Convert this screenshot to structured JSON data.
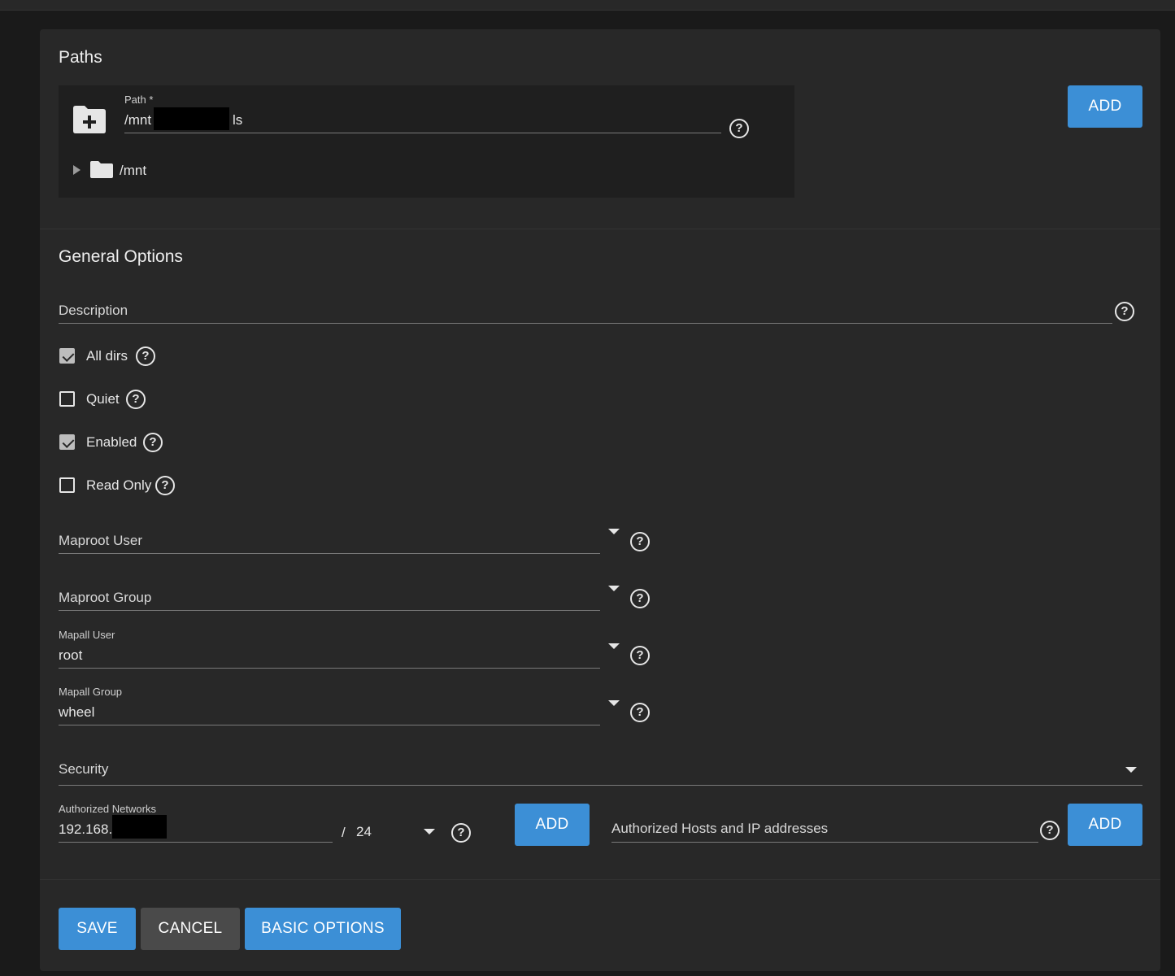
{
  "paths": {
    "title": "Paths",
    "path_label": "Path *",
    "path_value_prefix": "/mnt",
    "path_value_suffix": "ls",
    "tree_root": "/mnt",
    "add_label": "ADD"
  },
  "general": {
    "title": "General Options",
    "description_placeholder": "Description",
    "checkboxes": [
      {
        "label": "All dirs",
        "checked": true
      },
      {
        "label": "Quiet",
        "checked": false
      },
      {
        "label": "Enabled",
        "checked": true
      },
      {
        "label": "Read Only",
        "checked": false
      }
    ],
    "maproot_user": {
      "label": "Maproot User",
      "value": ""
    },
    "maproot_group": {
      "label": "Maproot Group",
      "value": ""
    },
    "mapall_user": {
      "label": "Mapall User",
      "value": "root"
    },
    "mapall_group": {
      "label": "Mapall Group",
      "value": "wheel"
    },
    "security": {
      "label": "Security"
    },
    "networks": {
      "label": "Authorized Networks",
      "value_prefix": "192.168.",
      "separator": "/",
      "mask": "24",
      "add_label": "ADD"
    },
    "hosts": {
      "placeholder": "Authorized Hosts and IP addresses",
      "add_label": "ADD"
    }
  },
  "footer": {
    "save_label": "SAVE",
    "cancel_label": "CANCEL",
    "basic_label": "BASIC OPTIONS"
  },
  "colors": {
    "primary": "#3c8fd6",
    "card": "#282828",
    "background": "#1a1a1a"
  },
  "icons": {
    "help": "?"
  }
}
